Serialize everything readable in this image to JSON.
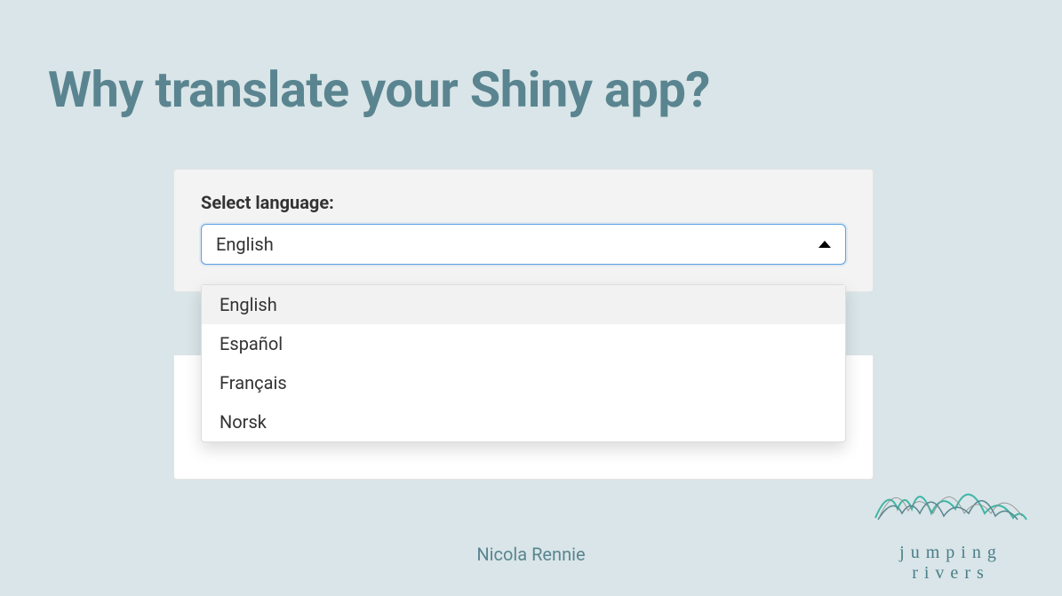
{
  "title": "Why translate your Shiny app?",
  "dropdown": {
    "label": "Select language:",
    "selected": "English",
    "options": [
      "English",
      "Español",
      "Français",
      "Norsk"
    ]
  },
  "author": "Nicola Rennie",
  "logo": {
    "text": "jumping rivers"
  }
}
